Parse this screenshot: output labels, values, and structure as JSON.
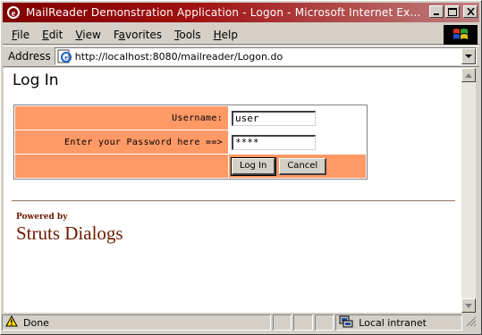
{
  "window": {
    "title": "MailReader Demonstration Application - Logon - Microsoft Internet Ex..."
  },
  "menu": {
    "items": [
      {
        "label": "File",
        "key": "F",
        "rest": "ile"
      },
      {
        "label": "Edit",
        "key": "E",
        "rest": "dit"
      },
      {
        "label": "View",
        "key": "V",
        "rest": "iew"
      },
      {
        "label": "Favorites",
        "key": "a",
        "pre": "F",
        "rest": "vorites"
      },
      {
        "label": "Tools",
        "key": "T",
        "rest": "ools"
      },
      {
        "label": "Help",
        "key": "H",
        "rest": "elp"
      }
    ]
  },
  "address": {
    "label": "Address",
    "url": "http://localhost:8080/mailreader/Logon.do"
  },
  "page": {
    "title": "Log In",
    "username_label": "Username:",
    "username_value": "user",
    "password_label": "Enter your Password here ==>",
    "password_value": "****",
    "login_button": "Log In",
    "cancel_button": "Cancel",
    "powered_by": "Powered by",
    "brand": "Struts Dialogs"
  },
  "status": {
    "text": "Done",
    "zone": "Local intranet"
  },
  "colors": {
    "titlebar": "#800000",
    "form_cell": "#ff9966",
    "brand_text": "#6b1a00"
  }
}
